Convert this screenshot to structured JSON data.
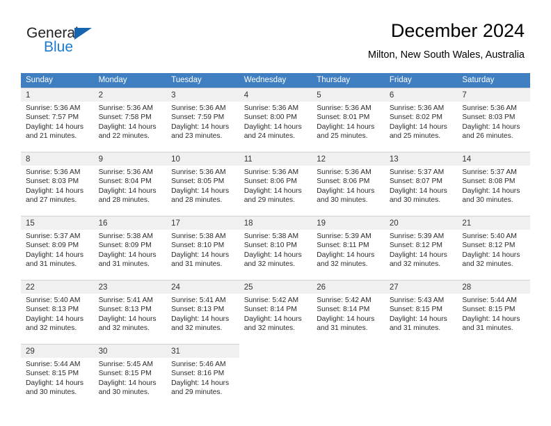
{
  "brand": {
    "name_part1": "General",
    "name_part2": "Blue",
    "accent_color": "#1a7ad1",
    "triangle_color": "#1565b0"
  },
  "header": {
    "title": "December 2024",
    "subtitle": "Milton, New South Wales, Australia"
  },
  "calendar": {
    "header_bg": "#3f7fc1",
    "daynum_bg": "#f0f0f0",
    "weekday_names": [
      "Sunday",
      "Monday",
      "Tuesday",
      "Wednesday",
      "Thursday",
      "Friday",
      "Saturday"
    ],
    "weeks": [
      [
        {
          "day": "1",
          "sunrise": "Sunrise: 5:36 AM",
          "sunset": "Sunset: 7:57 PM",
          "daylight1": "Daylight: 14 hours",
          "daylight2": "and 21 minutes."
        },
        {
          "day": "2",
          "sunrise": "Sunrise: 5:36 AM",
          "sunset": "Sunset: 7:58 PM",
          "daylight1": "Daylight: 14 hours",
          "daylight2": "and 22 minutes."
        },
        {
          "day": "3",
          "sunrise": "Sunrise: 5:36 AM",
          "sunset": "Sunset: 7:59 PM",
          "daylight1": "Daylight: 14 hours",
          "daylight2": "and 23 minutes."
        },
        {
          "day": "4",
          "sunrise": "Sunrise: 5:36 AM",
          "sunset": "Sunset: 8:00 PM",
          "daylight1": "Daylight: 14 hours",
          "daylight2": "and 24 minutes."
        },
        {
          "day": "5",
          "sunrise": "Sunrise: 5:36 AM",
          "sunset": "Sunset: 8:01 PM",
          "daylight1": "Daylight: 14 hours",
          "daylight2": "and 25 minutes."
        },
        {
          "day": "6",
          "sunrise": "Sunrise: 5:36 AM",
          "sunset": "Sunset: 8:02 PM",
          "daylight1": "Daylight: 14 hours",
          "daylight2": "and 25 minutes."
        },
        {
          "day": "7",
          "sunrise": "Sunrise: 5:36 AM",
          "sunset": "Sunset: 8:03 PM",
          "daylight1": "Daylight: 14 hours",
          "daylight2": "and 26 minutes."
        }
      ],
      [
        {
          "day": "8",
          "sunrise": "Sunrise: 5:36 AM",
          "sunset": "Sunset: 8:03 PM",
          "daylight1": "Daylight: 14 hours",
          "daylight2": "and 27 minutes."
        },
        {
          "day": "9",
          "sunrise": "Sunrise: 5:36 AM",
          "sunset": "Sunset: 8:04 PM",
          "daylight1": "Daylight: 14 hours",
          "daylight2": "and 28 minutes."
        },
        {
          "day": "10",
          "sunrise": "Sunrise: 5:36 AM",
          "sunset": "Sunset: 8:05 PM",
          "daylight1": "Daylight: 14 hours",
          "daylight2": "and 28 minutes."
        },
        {
          "day": "11",
          "sunrise": "Sunrise: 5:36 AM",
          "sunset": "Sunset: 8:06 PM",
          "daylight1": "Daylight: 14 hours",
          "daylight2": "and 29 minutes."
        },
        {
          "day": "12",
          "sunrise": "Sunrise: 5:36 AM",
          "sunset": "Sunset: 8:06 PM",
          "daylight1": "Daylight: 14 hours",
          "daylight2": "and 30 minutes."
        },
        {
          "day": "13",
          "sunrise": "Sunrise: 5:37 AM",
          "sunset": "Sunset: 8:07 PM",
          "daylight1": "Daylight: 14 hours",
          "daylight2": "and 30 minutes."
        },
        {
          "day": "14",
          "sunrise": "Sunrise: 5:37 AM",
          "sunset": "Sunset: 8:08 PM",
          "daylight1": "Daylight: 14 hours",
          "daylight2": "and 30 minutes."
        }
      ],
      [
        {
          "day": "15",
          "sunrise": "Sunrise: 5:37 AM",
          "sunset": "Sunset: 8:09 PM",
          "daylight1": "Daylight: 14 hours",
          "daylight2": "and 31 minutes."
        },
        {
          "day": "16",
          "sunrise": "Sunrise: 5:38 AM",
          "sunset": "Sunset: 8:09 PM",
          "daylight1": "Daylight: 14 hours",
          "daylight2": "and 31 minutes."
        },
        {
          "day": "17",
          "sunrise": "Sunrise: 5:38 AM",
          "sunset": "Sunset: 8:10 PM",
          "daylight1": "Daylight: 14 hours",
          "daylight2": "and 31 minutes."
        },
        {
          "day": "18",
          "sunrise": "Sunrise: 5:38 AM",
          "sunset": "Sunset: 8:10 PM",
          "daylight1": "Daylight: 14 hours",
          "daylight2": "and 32 minutes."
        },
        {
          "day": "19",
          "sunrise": "Sunrise: 5:39 AM",
          "sunset": "Sunset: 8:11 PM",
          "daylight1": "Daylight: 14 hours",
          "daylight2": "and 32 minutes."
        },
        {
          "day": "20",
          "sunrise": "Sunrise: 5:39 AM",
          "sunset": "Sunset: 8:12 PM",
          "daylight1": "Daylight: 14 hours",
          "daylight2": "and 32 minutes."
        },
        {
          "day": "21",
          "sunrise": "Sunrise: 5:40 AM",
          "sunset": "Sunset: 8:12 PM",
          "daylight1": "Daylight: 14 hours",
          "daylight2": "and 32 minutes."
        }
      ],
      [
        {
          "day": "22",
          "sunrise": "Sunrise: 5:40 AM",
          "sunset": "Sunset: 8:13 PM",
          "daylight1": "Daylight: 14 hours",
          "daylight2": "and 32 minutes."
        },
        {
          "day": "23",
          "sunrise": "Sunrise: 5:41 AM",
          "sunset": "Sunset: 8:13 PM",
          "daylight1": "Daylight: 14 hours",
          "daylight2": "and 32 minutes."
        },
        {
          "day": "24",
          "sunrise": "Sunrise: 5:41 AM",
          "sunset": "Sunset: 8:13 PM",
          "daylight1": "Daylight: 14 hours",
          "daylight2": "and 32 minutes."
        },
        {
          "day": "25",
          "sunrise": "Sunrise: 5:42 AM",
          "sunset": "Sunset: 8:14 PM",
          "daylight1": "Daylight: 14 hours",
          "daylight2": "and 32 minutes."
        },
        {
          "day": "26",
          "sunrise": "Sunrise: 5:42 AM",
          "sunset": "Sunset: 8:14 PM",
          "daylight1": "Daylight: 14 hours",
          "daylight2": "and 31 minutes."
        },
        {
          "day": "27",
          "sunrise": "Sunrise: 5:43 AM",
          "sunset": "Sunset: 8:15 PM",
          "daylight1": "Daylight: 14 hours",
          "daylight2": "and 31 minutes."
        },
        {
          "day": "28",
          "sunrise": "Sunrise: 5:44 AM",
          "sunset": "Sunset: 8:15 PM",
          "daylight1": "Daylight: 14 hours",
          "daylight2": "and 31 minutes."
        }
      ],
      [
        {
          "day": "29",
          "sunrise": "Sunrise: 5:44 AM",
          "sunset": "Sunset: 8:15 PM",
          "daylight1": "Daylight: 14 hours",
          "daylight2": "and 30 minutes."
        },
        {
          "day": "30",
          "sunrise": "Sunrise: 5:45 AM",
          "sunset": "Sunset: 8:15 PM",
          "daylight1": "Daylight: 14 hours",
          "daylight2": "and 30 minutes."
        },
        {
          "day": "31",
          "sunrise": "Sunrise: 5:46 AM",
          "sunset": "Sunset: 8:16 PM",
          "daylight1": "Daylight: 14 hours",
          "daylight2": "and 29 minutes."
        },
        null,
        null,
        null,
        null
      ]
    ]
  }
}
